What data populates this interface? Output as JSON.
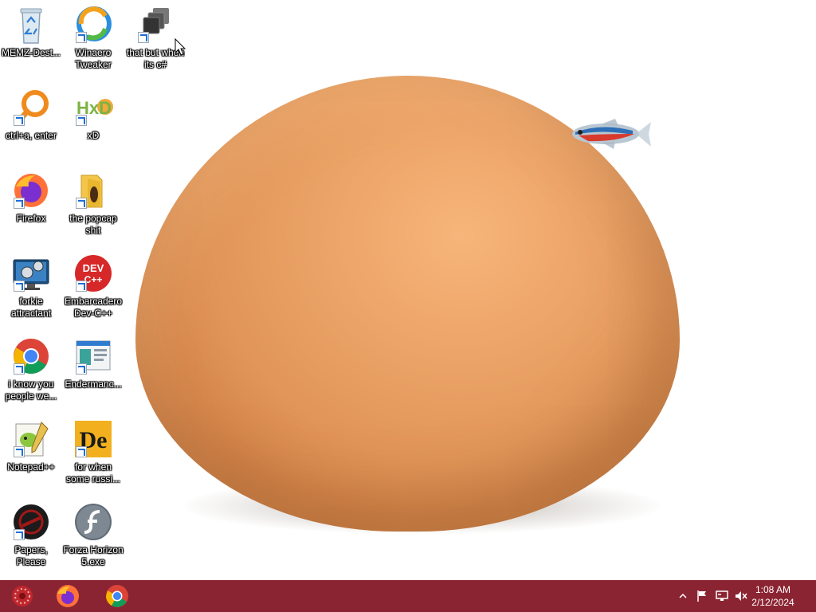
{
  "desktop": {
    "icons": [
      {
        "label": "MEMZ-Dest...",
        "icon": "recycle-bin-icon"
      },
      {
        "label": "Winaero Tweaker",
        "icon": "winaero-icon"
      },
      {
        "label": "that but when its c#",
        "icon": "stacked-windows-icon"
      },
      {
        "label": "ctrl+a, enter",
        "icon": "magnifier-orange-icon"
      },
      {
        "label": "xD",
        "icon": "hxd-icon"
      },
      {
        "label": "Firefox",
        "icon": "firefox-icon"
      },
      {
        "label": "the popcap shit",
        "icon": "folder-icon"
      },
      {
        "label": "forkie attractant",
        "icon": "computer-gears-icon"
      },
      {
        "label": "Embarcadero Dev-C++",
        "icon": "devcpp-icon"
      },
      {
        "label": "i know you people we...",
        "icon": "chrome-icon"
      },
      {
        "label": "Endermanc...",
        "icon": "window-app-icon"
      },
      {
        "label": "Notepad++",
        "icon": "notepadpp-icon"
      },
      {
        "label": "for when some russi...",
        "icon": "de-app-icon"
      },
      {
        "label": "Papers, Please",
        "icon": "papers-please-icon"
      },
      {
        "label": "Forza Horizon 5.exe",
        "icon": "flash-icon"
      }
    ],
    "dev_icon_text": "DEV",
    "devcpp_sub": "C++",
    "de_icon_text": "De",
    "hxd_icon_text": "HxD"
  },
  "taskbar": {
    "clock_time": "1:08 AM",
    "clock_date": "2/12/2024",
    "color": "#8b2432"
  }
}
